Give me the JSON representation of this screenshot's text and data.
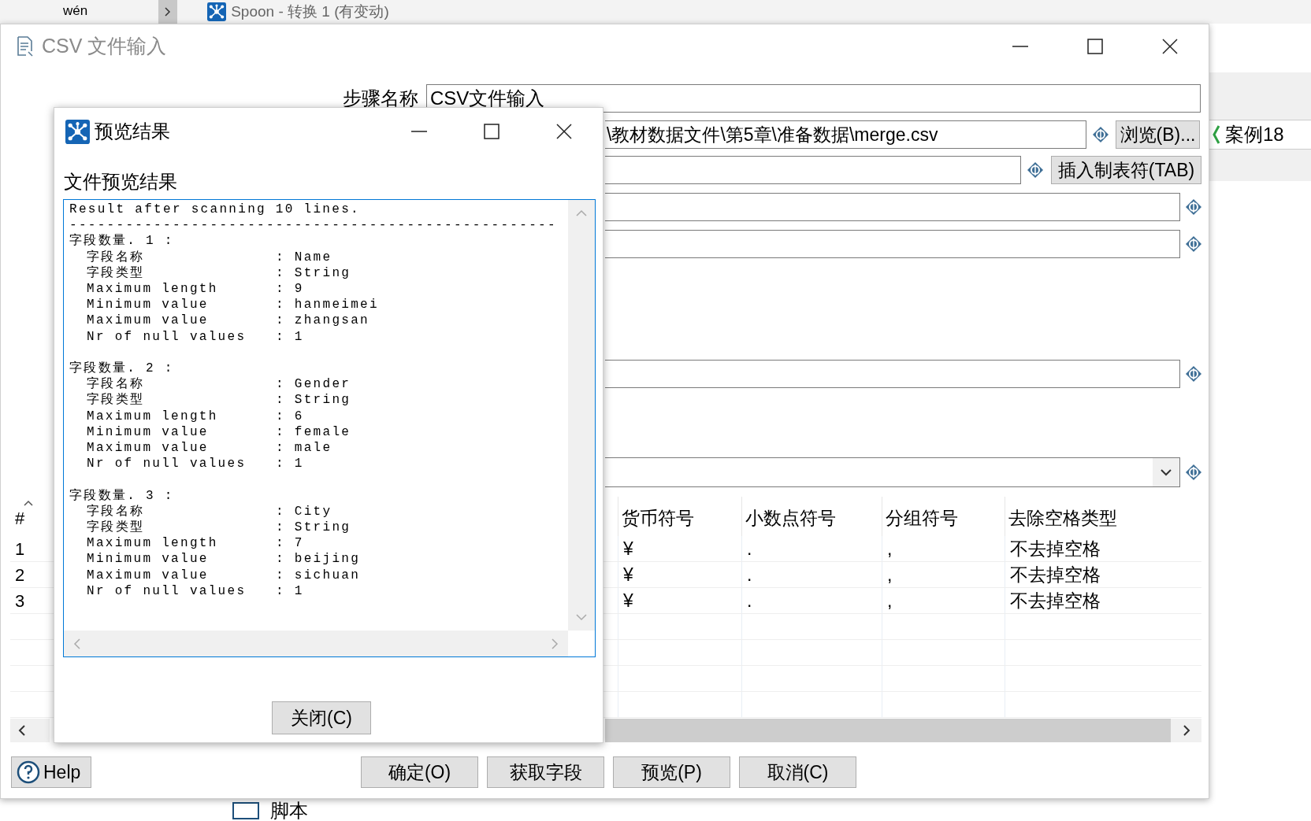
{
  "background_window": {
    "toolbar_text": "wén",
    "title": "Spoon - 转换 1 (有变动)",
    "side_tab": "案例18",
    "bottom_item": {
      "label": "脚本",
      "checked": false
    }
  },
  "csv_dialog": {
    "title": "CSV 文件输入",
    "step_name": {
      "label": "步骤名称",
      "value": "CSV文件输入"
    },
    "filename": {
      "value": "\\教材数据文件\\第5章\\准备数据\\merge.csv"
    },
    "browse_button": "浏览(B)...",
    "insert_tab_button": "插入制表符(TAB)",
    "table": {
      "number_column": "#",
      "columns": [
        "货币符号",
        "小数点符号",
        "分组符号",
        "去除空格类型"
      ],
      "rows": [
        {
          "number": "1",
          "cells": [
            "¥",
            ".",
            ",",
            "不去掉空格"
          ]
        },
        {
          "number": "2",
          "cells": [
            "¥",
            ".",
            ",",
            "不去掉空格"
          ]
        },
        {
          "number": "3",
          "cells": [
            "¥",
            ".",
            ",",
            "不去掉空格"
          ]
        }
      ]
    },
    "help_button": "Help",
    "buttons": [
      "确定(O)",
      "获取字段",
      "预览(P)",
      "取消(C)"
    ]
  },
  "preview_dialog": {
    "title": "预览结果",
    "label": "文件预览结果",
    "header": "Result after scanning 10 lines.",
    "divider": "----------------------------------------------------",
    "fields": [
      {
        "heading": "字段数量. 1 :",
        "rows": [
          {
            "label": "字段名称",
            "value": ": Name"
          },
          {
            "label": "字段类型",
            "value": ": String"
          },
          {
            "label": "Maximum length",
            "value": ": 9"
          },
          {
            "label": "Minimum value",
            "value": ": hanmeimei"
          },
          {
            "label": "Maximum value",
            "value": ": zhangsan"
          },
          {
            "label": "Nr of null values",
            "value": ": 1"
          }
        ]
      },
      {
        "heading": "字段数量. 2 :",
        "rows": [
          {
            "label": "字段名称",
            "value": ": Gender"
          },
          {
            "label": "字段类型",
            "value": ": String"
          },
          {
            "label": "Maximum length",
            "value": ": 6"
          },
          {
            "label": "Minimum value",
            "value": ": female"
          },
          {
            "label": "Maximum value",
            "value": ": male"
          },
          {
            "label": "Nr of null values",
            "value": ": 1"
          }
        ]
      },
      {
        "heading": "字段数量. 3 :",
        "rows": [
          {
            "label": "字段名称",
            "value": ": City"
          },
          {
            "label": "字段类型",
            "value": ": String"
          },
          {
            "label": "Maximum length",
            "value": ": 7"
          },
          {
            "label": "Minimum value",
            "value": ": beijing"
          },
          {
            "label": "Maximum value",
            "value": ": sichuan"
          },
          {
            "label": "Nr of null values",
            "value": ": 1"
          }
        ]
      }
    ],
    "close_button": "关闭(C)"
  }
}
